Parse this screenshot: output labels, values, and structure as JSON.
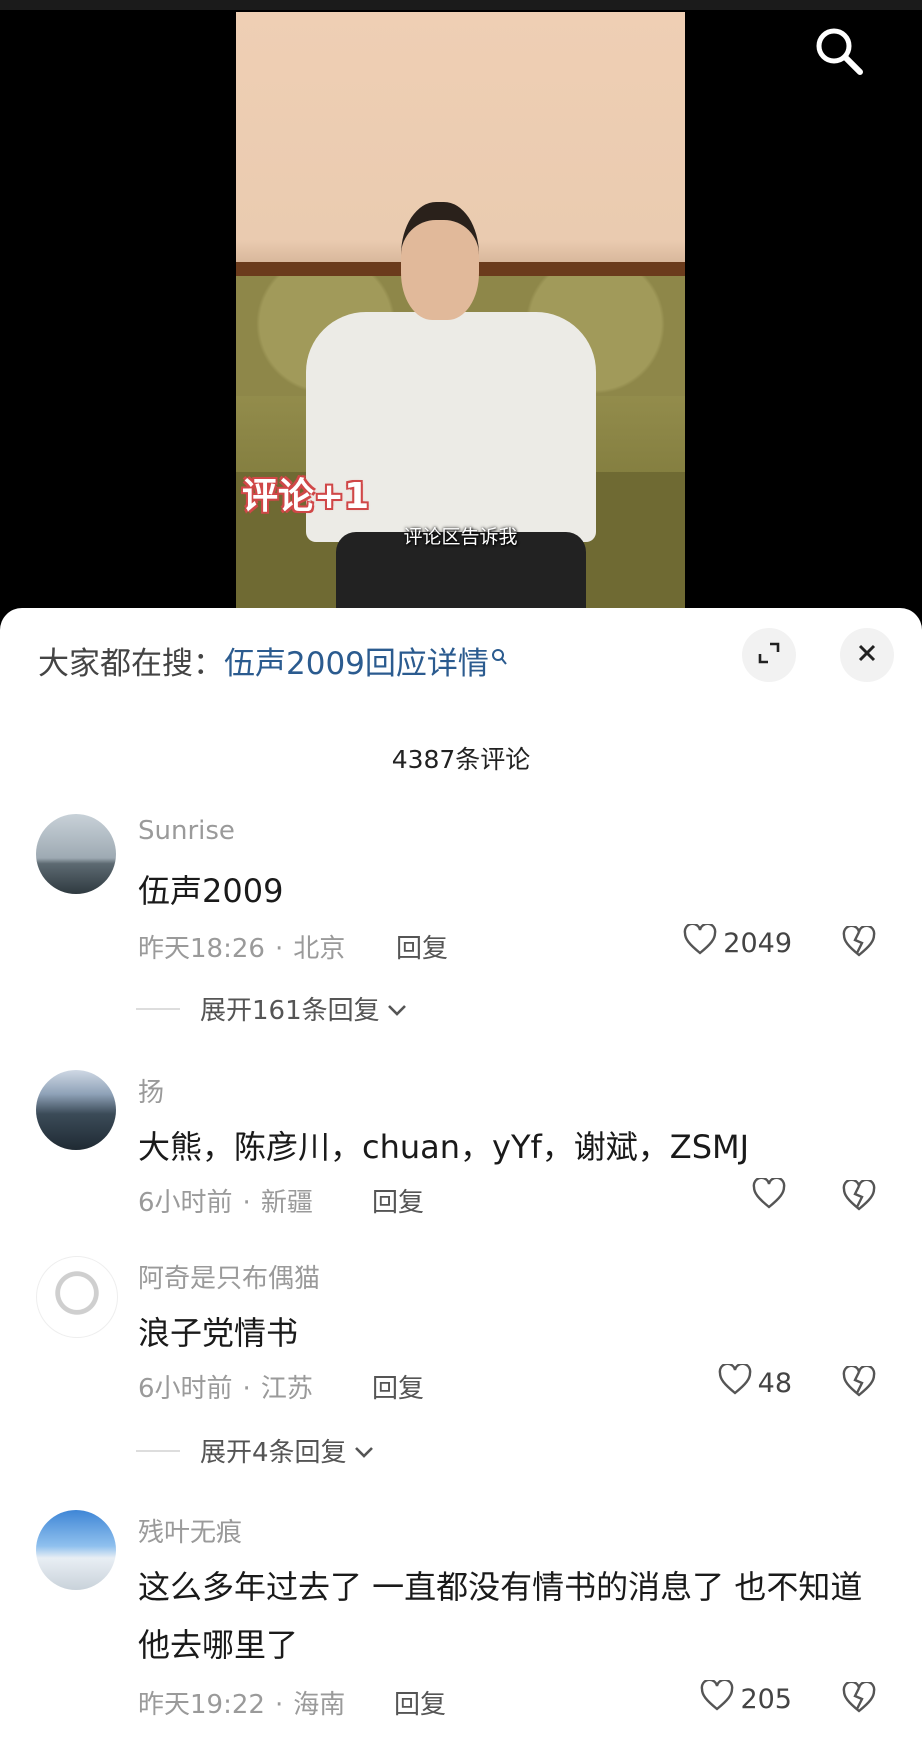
{
  "video": {
    "sticker_text": "评论+1",
    "caption": "评论区告诉我"
  },
  "icons": {
    "search": "search-icon",
    "expand": "expand-icon",
    "close": "close-icon",
    "like": "heart-icon",
    "dislike": "broken-heart-icon",
    "chevron": "chevron-down-icon"
  },
  "sheet": {
    "search_prefix": "大家都在搜：",
    "search_term": "伍声2009回应详情",
    "comment_count": "4387条评论"
  },
  "comments": [
    {
      "user": "Sunrise",
      "text": "伍声2009",
      "time": "昨天18:26",
      "location": "北京",
      "reply_label": "回复",
      "likes": "2049",
      "expand_label": "展开161条回复"
    },
    {
      "user": "扬",
      "text": "大熊，陈彦川，chuan，yYf，谢斌，ZSMJ",
      "time": "6小时前",
      "location": "新疆",
      "reply_label": "回复",
      "likes": ""
    },
    {
      "user": "阿奇是只布偶猫",
      "text": "浪子党情书",
      "time": "6小时前",
      "location": "江苏",
      "reply_label": "回复",
      "likes": "48",
      "expand_label": "展开4条回复"
    },
    {
      "user": "残叶无痕",
      "text": "这么多年过去了  一直都没有情书的消息了  也不知道他去哪里了",
      "time": "昨天19:22",
      "location": "海南",
      "reply_label": "回复",
      "likes": "205"
    }
  ]
}
